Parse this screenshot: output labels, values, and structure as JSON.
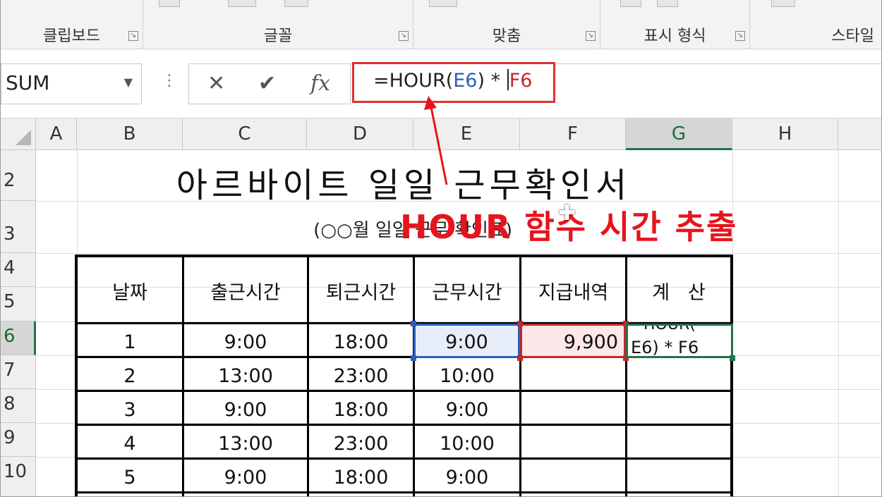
{
  "ribbon": {
    "groups": [
      {
        "label": "클립보드",
        "launcher": "↘"
      },
      {
        "label": "글꼴",
        "launcher": "↘"
      },
      {
        "label": "맞춤",
        "launcher": "↘"
      },
      {
        "label": "표시 형식",
        "launcher": "↘"
      },
      {
        "label": "스타일"
      }
    ]
  },
  "formula_bar": {
    "name_box": "SUM",
    "cancel_icon": "✕",
    "enter_icon": "✔",
    "fx_icon": "fx",
    "formula_prefix": "=HOUR(",
    "formula_ref_e": "E6",
    "formula_mid": ") * ",
    "formula_ref_f": "F6"
  },
  "columns": [
    "A",
    "B",
    "C",
    "D",
    "E",
    "F",
    "G",
    "H"
  ],
  "rows": [
    "2",
    "3",
    "4",
    "5",
    "6",
    "7",
    "8",
    "9",
    "10"
  ],
  "sheet": {
    "title": "아르바이트 일일 근무확인서",
    "subtitle": "(○○월 일일 근무 확인표)",
    "annotation": "HOUR 함수 시간 추출",
    "table_headers": [
      "날짜",
      "출근시간",
      "퇴근시간",
      "근무시간",
      "지급내역",
      "계   산"
    ],
    "table_rows": [
      [
        "1",
        "9:00",
        "18:00",
        "9:00",
        "9,900",
        ""
      ],
      [
        "2",
        "13:00",
        "23:00",
        "10:00",
        "",
        ""
      ],
      [
        "3",
        "9:00",
        "18:00",
        "9:00",
        "",
        ""
      ],
      [
        "4",
        "13:00",
        "23:00",
        "10:00",
        "",
        ""
      ],
      [
        "5",
        "9:00",
        "18:00",
        "9:00",
        "",
        ""
      ]
    ],
    "editing_cell": {
      "line1": "HOUR(",
      "line2": "E6) * F6"
    }
  },
  "colors": {
    "accent_red": "#e8131c",
    "ref_blue": "#2b5fb8",
    "ref_red": "#c0282c",
    "select_green": "#217346"
  }
}
